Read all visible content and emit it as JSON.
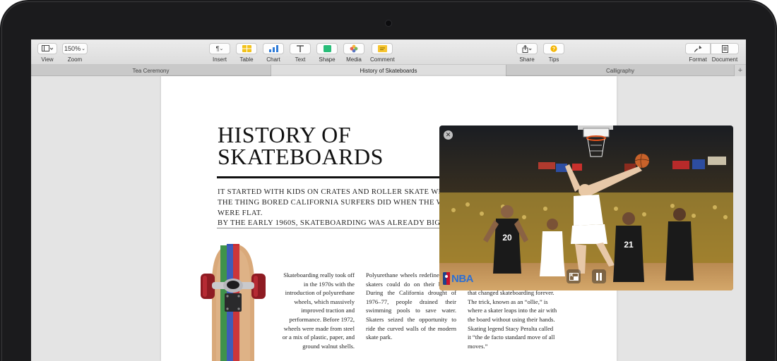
{
  "toolbar": {
    "view_label": "View",
    "zoom_label": "Zoom",
    "zoom_value": "150%",
    "insert_label": "Insert",
    "table_label": "Table",
    "chart_label": "Chart",
    "text_label": "Text",
    "shape_label": "Shape",
    "media_label": "Media",
    "comment_label": "Comment",
    "share_label": "Share",
    "tips_label": "Tips",
    "format_label": "Format",
    "document_label": "Document"
  },
  "tabs": [
    {
      "label": "Tea Ceremony"
    },
    {
      "label": "History of Skateboards"
    },
    {
      "label": "Calligraphy"
    }
  ],
  "document": {
    "title": "HISTORY OF SKATEBOARDS",
    "intro": "IT STARTED WITH KIDS ON CRATES AND ROLLER SKATE WHEELS.\nTHE THING BORED CALIFORNIA SURFERS DID WHEN THE WAVES WERE FLAT.\nBY THE EARLY 1960S, SKATEBOARDING WAS ALREADY BIG.",
    "col1": "Skateboarding really took off in the 1970s with the introduction of polyurethane wheels, which massively improved traction and performance. Before 1972, wheels were made from steel or a mix of plastic, paper, and ground walnut shells.",
    "col2": "Polyurethane wheels redefined what skaters could do on their boards. During the California drought of 1976–77, people drained their swimming pools to save water. Skaters seized the opportunity to ride the curved walls of the modern skate park.",
    "col3": "In 1978, 14-year-old Alan “Ollie” Gelfand perfected a move in Florida that changed skateboarding forever. The trick, known as an “ollie,” is where a skater leaps into the air with the board without using their hands. Skating legend Stacy Peralta called it “the de facto standard move of all moves.”"
  },
  "video": {
    "logo_text": "NBA",
    "jersey_numbers": [
      "20",
      "21"
    ]
  },
  "colors": {
    "board_stripe_green": "#2f8a3c",
    "board_stripe_blue": "#2e4fb4",
    "board_stripe_red": "#c8252a",
    "jersey_gold_state": "#ffffff",
    "jersey_spurs": "#1a1a1a"
  }
}
